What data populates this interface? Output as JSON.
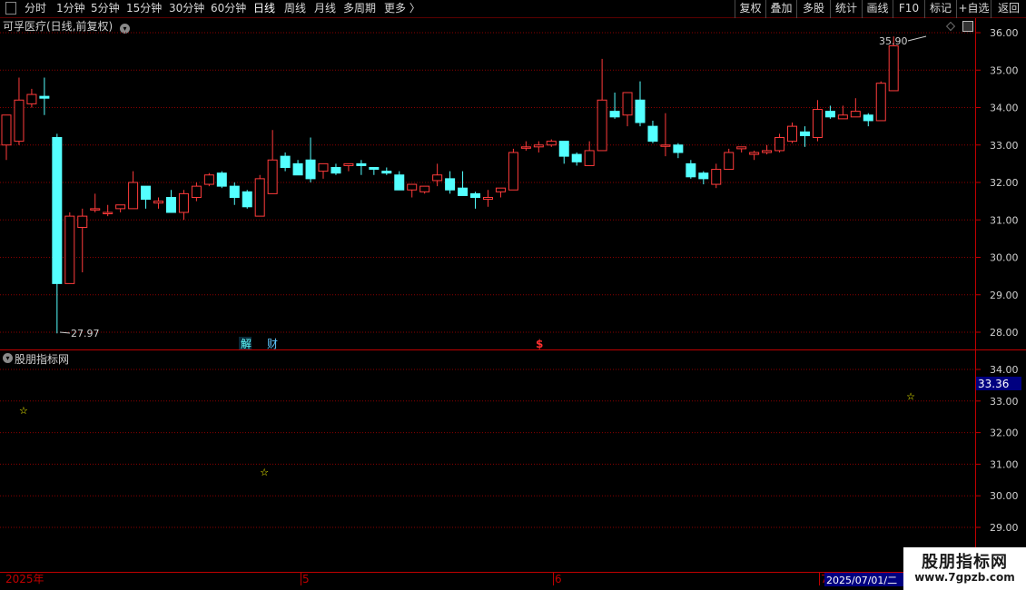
{
  "toolbar": {
    "periods": [
      {
        "label": "分时"
      },
      {
        "label": "1分钟"
      },
      {
        "label": "5分钟"
      },
      {
        "label": "15分钟"
      },
      {
        "label": "30分钟"
      },
      {
        "label": "60分钟"
      },
      {
        "label": "日线",
        "active": true
      },
      {
        "label": "周线"
      },
      {
        "label": "月线"
      },
      {
        "label": "多周期"
      },
      {
        "label": "更多 〉"
      }
    ],
    "right_buttons": [
      {
        "label": "复权"
      },
      {
        "label": "叠加"
      },
      {
        "label": "多股"
      },
      {
        "label": "统计"
      },
      {
        "label": "画线"
      },
      {
        "label": "F10"
      },
      {
        "label": "标记"
      },
      {
        "label": "+自选"
      },
      {
        "label": "返回"
      }
    ]
  },
  "main_chart": {
    "title": "可孚医疗(日线,前复权)",
    "high_label": "35.90",
    "low_label": "27.97",
    "markers": [
      {
        "label": "解"
      },
      {
        "label": "财"
      },
      {
        "label": "$"
      }
    ],
    "y_ticks": [
      "36.00",
      "35.00",
      "34.00",
      "33.00",
      "32.00",
      "31.00",
      "30.00",
      "29.00",
      "28.00"
    ]
  },
  "sub_chart": {
    "title": "股朋指标网",
    "y_ticks": [
      "34.00",
      "33.00",
      "32.00",
      "31.00",
      "30.00",
      "29.00"
    ],
    "current_value": "33.36"
  },
  "x_axis": {
    "labels": [
      "2025年",
      "5",
      "6",
      "7"
    ],
    "cursor_date": "2025/07/01/二"
  },
  "watermark": {
    "name": "股朋指标网",
    "url": "www.7gpzb.com"
  },
  "colors": {
    "up": "#ff3b3b",
    "down": "#54ffff",
    "grid": "#8b0000",
    "star": "#ffff00",
    "value_box": "#000080"
  },
  "chart_data": {
    "type": "candlestick",
    "series": [
      {
        "values": [
          [
            33.0,
            33.8,
            33.8,
            32.6
          ],
          [
            33.1,
            34.2,
            34.8,
            33.0
          ],
          [
            34.1,
            34.35,
            34.5,
            34.0
          ],
          [
            34.3,
            34.25,
            34.8,
            33.8
          ],
          [
            33.2,
            29.3,
            33.3,
            27.97
          ],
          [
            29.3,
            31.1,
            31.2,
            29.3
          ],
          [
            30.8,
            31.1,
            31.3,
            29.6
          ],
          [
            31.3,
            31.3,
            31.7,
            31.2
          ],
          [
            31.2,
            31.2,
            31.4,
            31.1
          ],
          [
            31.3,
            31.4,
            31.4,
            31.2
          ],
          [
            31.3,
            32.0,
            32.3,
            31.3
          ],
          [
            31.9,
            31.55,
            31.9,
            31.3
          ],
          [
            31.45,
            31.5,
            31.6,
            31.3
          ],
          [
            31.6,
            31.2,
            31.8,
            31.2
          ],
          [
            31.2,
            31.7,
            31.8,
            31.0
          ],
          [
            31.6,
            31.9,
            32.0,
            31.5
          ],
          [
            31.95,
            32.2,
            32.25,
            31.9
          ],
          [
            32.25,
            31.9,
            32.3,
            31.85
          ],
          [
            31.9,
            31.6,
            32.0,
            31.4
          ],
          [
            31.75,
            31.35,
            31.8,
            31.3
          ],
          [
            31.1,
            32.1,
            32.2,
            31.1
          ],
          [
            31.7,
            32.6,
            33.4,
            31.7
          ],
          [
            32.7,
            32.4,
            32.8,
            32.3
          ],
          [
            32.5,
            32.2,
            32.6,
            32.2
          ],
          [
            32.6,
            32.1,
            33.2,
            32.0
          ],
          [
            32.3,
            32.5,
            32.5,
            32.1
          ],
          [
            32.4,
            32.25,
            32.5,
            32.2
          ],
          [
            32.45,
            32.5,
            32.5,
            32.3
          ],
          [
            32.5,
            32.45,
            32.6,
            32.2
          ],
          [
            32.4,
            32.35,
            32.4,
            32.2
          ],
          [
            32.3,
            32.25,
            32.4,
            32.2
          ],
          [
            32.2,
            31.8,
            32.3,
            31.8
          ],
          [
            31.8,
            31.95,
            31.9,
            31.6
          ],
          [
            31.75,
            31.9,
            31.9,
            31.7
          ],
          [
            32.05,
            32.2,
            32.5,
            31.9
          ],
          [
            32.1,
            31.8,
            32.3,
            31.7
          ],
          [
            31.85,
            31.65,
            32.3,
            31.65
          ],
          [
            31.7,
            31.6,
            31.75,
            31.3
          ],
          [
            31.55,
            31.6,
            31.8,
            31.35
          ],
          [
            31.75,
            31.85,
            31.85,
            31.6
          ],
          [
            31.8,
            32.8,
            32.9,
            31.8
          ],
          [
            32.95,
            32.95,
            33.1,
            32.85
          ],
          [
            32.95,
            33.0,
            33.1,
            32.8
          ],
          [
            33.0,
            33.1,
            33.15,
            32.95
          ],
          [
            33.1,
            32.7,
            33.1,
            32.5
          ],
          [
            32.75,
            32.55,
            32.8,
            32.45
          ],
          [
            32.45,
            32.85,
            33.1,
            32.45
          ],
          [
            32.85,
            34.2,
            35.3,
            32.85
          ],
          [
            33.9,
            33.75,
            34.4,
            33.7
          ],
          [
            33.8,
            34.4,
            34.4,
            33.5
          ],
          [
            34.2,
            33.6,
            34.7,
            33.5
          ],
          [
            33.5,
            33.1,
            33.65,
            33.05
          ],
          [
            33.0,
            33.0,
            33.85,
            32.7
          ],
          [
            33.0,
            32.8,
            33.05,
            32.65
          ],
          [
            32.5,
            32.15,
            32.6,
            32.1
          ],
          [
            32.25,
            32.1,
            32.3,
            31.95
          ],
          [
            31.95,
            32.35,
            32.5,
            31.85
          ],
          [
            32.35,
            32.8,
            32.9,
            32.35
          ],
          [
            32.9,
            32.95,
            32.95,
            32.8
          ],
          [
            32.75,
            32.8,
            32.85,
            32.6
          ],
          [
            32.8,
            32.85,
            33.0,
            32.75
          ],
          [
            32.85,
            33.2,
            33.3,
            32.8
          ],
          [
            33.1,
            33.5,
            33.6,
            33.05
          ],
          [
            33.35,
            33.25,
            33.5,
            32.95
          ],
          [
            33.2,
            33.95,
            34.2,
            33.1
          ],
          [
            33.9,
            33.75,
            34.05,
            33.7
          ],
          [
            33.7,
            33.8,
            34.05,
            33.7
          ],
          [
            33.75,
            33.9,
            34.25,
            33.75
          ],
          [
            33.8,
            33.65,
            33.85,
            33.5
          ],
          [
            33.65,
            34.65,
            34.7,
            33.65
          ],
          [
            34.45,
            35.65,
            35.9,
            34.45
          ]
        ]
      }
    ],
    "value_order": [
      "open",
      "close",
      "high",
      "low"
    ],
    "y_range": [
      27.6,
      36.3
    ],
    "sub_y_range": [
      28.6,
      34.3
    ],
    "signals": [
      {
        "index": 1,
        "value": 32.7
      },
      {
        "index": 20,
        "value": 30.75
      },
      {
        "index": 71,
        "value": 33.15
      }
    ]
  }
}
